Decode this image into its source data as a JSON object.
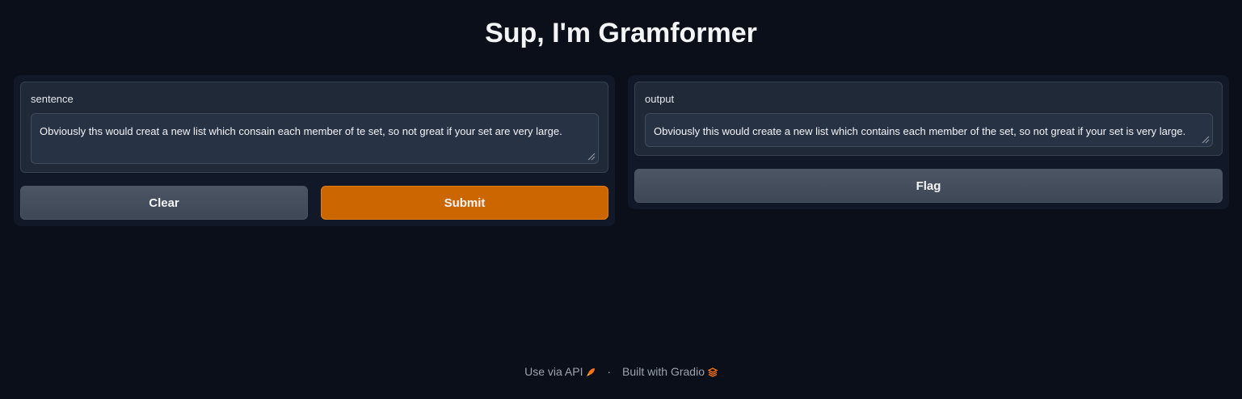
{
  "page": {
    "title": "Sup, I'm Gramformer"
  },
  "input": {
    "label": "sentence",
    "value": "Obviously ths would creat a new list which consain each member of te set, so not great if your set are very large."
  },
  "output": {
    "label": "output",
    "value": "Obviously this would create a new list which contains each member of the set, so not great if your set is very large."
  },
  "buttons": {
    "clear": "Clear",
    "submit": "Submit",
    "flag": "Flag"
  },
  "footer": {
    "api": "Use via API",
    "separator": "·",
    "built": "Built with Gradio"
  },
  "icons": {
    "api": "rocket-icon",
    "gradio": "gradio-logo-icon"
  },
  "colors": {
    "primary": "#cc6600",
    "background": "#0b0f19"
  }
}
